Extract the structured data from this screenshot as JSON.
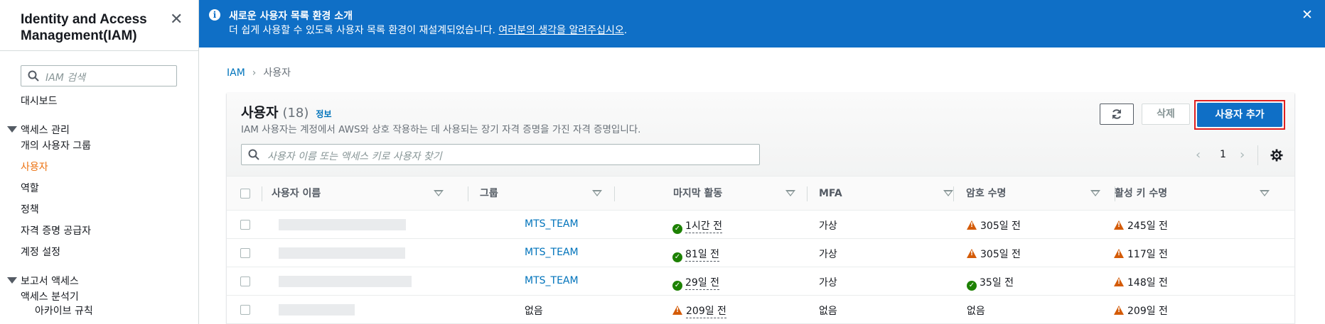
{
  "sidebar": {
    "title": "Identity and Access Management(IAM)",
    "search_placeholder": "IAM 검색",
    "dashboard": "대시보드",
    "access_mgmt": "액세스 관리",
    "items": [
      "개의 사용자 그룹",
      "사용자",
      "역할",
      "정책",
      "자격 증명 공급자",
      "계정 설정"
    ],
    "reports": "보고서 액세스",
    "report_items": [
      "액세스 분석기",
      "아카이브 규칙"
    ]
  },
  "banner": {
    "title": "새로운 사용자 목록 환경 소개",
    "body": "더 쉽게 사용할 수 있도록 사용자 목록 환경이 재설계되었습니다.",
    "link": "여러분의 생각을 알려주십시오",
    "link_suffix": "."
  },
  "breadcrumb": {
    "root": "IAM",
    "current": "사용자"
  },
  "panel": {
    "title": "사용자",
    "count": "(18)",
    "info": "정보",
    "description": "IAM 사용자는 계정에서 AWS와 상호 작용하는 데 사용되는 장기 자격 증명을 가진 자격 증명입니다.",
    "delete_label": "삭제",
    "add_label": "사용자 추가",
    "search_placeholder": "사용자 이름 또는 액세스 키로 사용자 찾기",
    "page": "1"
  },
  "table": {
    "columns": [
      "사용자 이름",
      "그룹",
      "마지막 활동",
      "MFA",
      "암호 수명",
      "활성 키 수명"
    ],
    "rows": [
      {
        "group": "MTS_TEAM",
        "activity": "1시간 전",
        "activity_status": "ok",
        "mfa": "가상",
        "password_age": "305일 전",
        "password_status": "warn",
        "key_age": "245일 전",
        "key_status": "warn"
      },
      {
        "group": "MTS_TEAM",
        "activity": "81일 전",
        "activity_status": "ok",
        "mfa": "가상",
        "password_age": "305일 전",
        "password_status": "warn",
        "key_age": "117일 전",
        "key_status": "warn"
      },
      {
        "group": "MTS_TEAM",
        "activity": "29일 전",
        "activity_status": "ok",
        "mfa": "가상",
        "password_age": "35일 전",
        "password_status": "ok",
        "key_age": "148일 전",
        "key_status": "warn"
      },
      {
        "group": "없음",
        "activity": "209일 전",
        "activity_status": "warn",
        "mfa": "없음",
        "password_age": "없음",
        "password_status": "none",
        "key_age": "209일 전",
        "key_status": "warn"
      }
    ]
  },
  "colors": {
    "accent": "#0f6fc6",
    "link": "#0073bb",
    "active_nav": "#ec7211",
    "ok": "#1d8102",
    "warn": "#d45b07",
    "highlight": "#e02020"
  },
  "icons": [
    "close-icon",
    "search-icon",
    "info-icon",
    "refresh-icon",
    "settings-icon",
    "chevron-left-icon",
    "chevron-right-icon",
    "caret-down-icon",
    "check-circle-icon",
    "warning-icon"
  ]
}
